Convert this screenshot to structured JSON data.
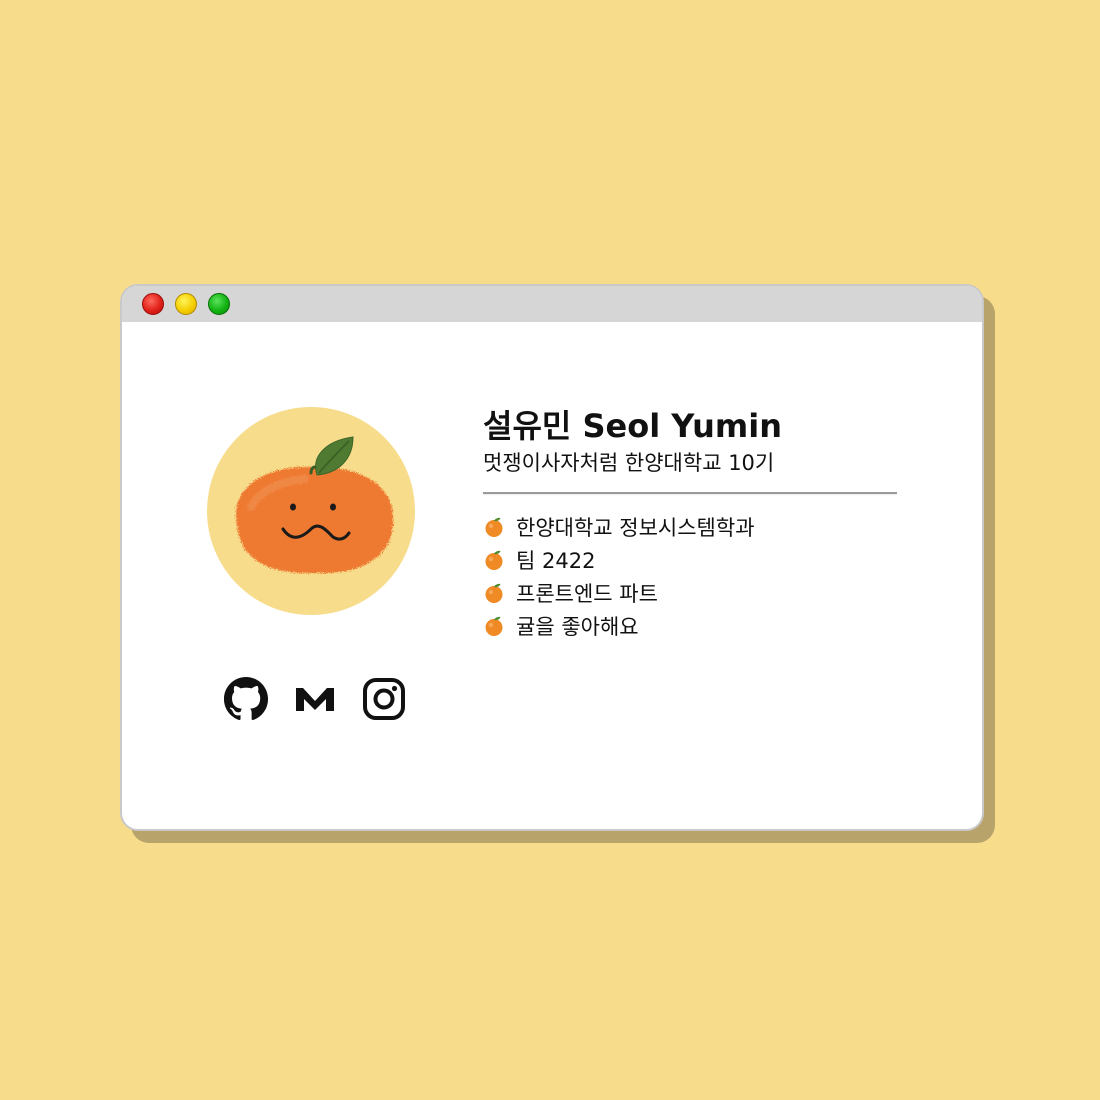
{
  "window": {
    "buttons": [
      "close",
      "minimize",
      "maximize"
    ]
  },
  "profile": {
    "name": "설유민 Seol Yumin",
    "subtitle": "멋쟁이사자처럼 한양대학교 10기",
    "avatar_icon": "tangerine-face-icon",
    "facts": [
      {
        "icon": "tangerine-icon",
        "text": "한양대학교 정보시스템학과"
      },
      {
        "icon": "tangerine-icon",
        "text": "팀 2422"
      },
      {
        "icon": "tangerine-icon",
        "text": "프론트엔드 파트"
      },
      {
        "icon": "tangerine-icon",
        "text": "귤을 좋아해요"
      }
    ],
    "socials": [
      {
        "icon": "github-icon"
      },
      {
        "icon": "medium-icon"
      },
      {
        "icon": "instagram-icon"
      }
    ]
  },
  "colors": {
    "background": "#f7dc8b",
    "window": "#ffffff",
    "titlebar": "#d6d6d6",
    "tangerine": "#ee7a30",
    "leaf": "#4e7a32"
  }
}
